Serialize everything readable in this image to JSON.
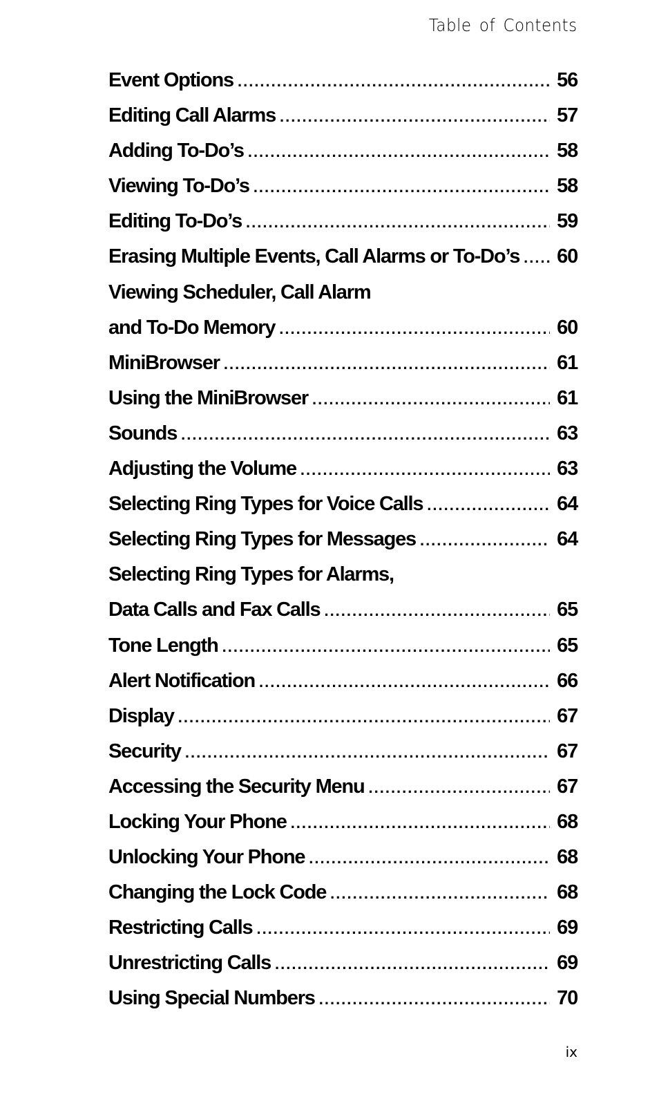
{
  "header": {
    "title": "Table of Contents"
  },
  "footer": {
    "page_number": "ix"
  },
  "entries": [
    {
      "title": "Event Options",
      "page": "56"
    },
    {
      "title": "Editing Call Alarms",
      "page": "57"
    },
    {
      "title": "Adding To-Do’s",
      "page": "58"
    },
    {
      "title": "Viewing To-Do’s",
      "page": "58"
    },
    {
      "title": "Editing To-Do’s",
      "page": "59"
    },
    {
      "title": "Erasing Multiple Events, Call Alarms or To-Do’s",
      "page": "60"
    },
    {
      "title": "Viewing Scheduler, Call Alarm",
      "page": ""
    },
    {
      "title": "and To-Do Memory",
      "page": "60"
    },
    {
      "title": "MiniBrowser",
      "page": "61"
    },
    {
      "title": "Using the MiniBrowser",
      "page": "61"
    },
    {
      "title": "Sounds",
      "page": "63"
    },
    {
      "title": "Adjusting the Volume",
      "page": "63"
    },
    {
      "title": "Selecting Ring Types for Voice Calls",
      "page": "64"
    },
    {
      "title": "Selecting Ring Types for Messages",
      "page": "64"
    },
    {
      "title": "Selecting Ring Types for Alarms,",
      "page": ""
    },
    {
      "title": "Data Calls and Fax Calls",
      "page": "65"
    },
    {
      "title": "Tone Length",
      "page": "65"
    },
    {
      "title": "Alert Notification",
      "page": "66"
    },
    {
      "title": "Display",
      "page": "67"
    },
    {
      "title": "Security",
      "page": "67"
    },
    {
      "title": "Accessing the Security Menu",
      "page": "67"
    },
    {
      "title": "Locking Your Phone",
      "page": "68"
    },
    {
      "title": "Unlocking Your Phone",
      "page": "68"
    },
    {
      "title": "Changing the Lock Code",
      "page": "68"
    },
    {
      "title": "Restricting Calls",
      "page": "69"
    },
    {
      "title": "Unrestricting Calls",
      "page": "69"
    },
    {
      "title": "Using Special Numbers",
      "page": "70"
    }
  ]
}
